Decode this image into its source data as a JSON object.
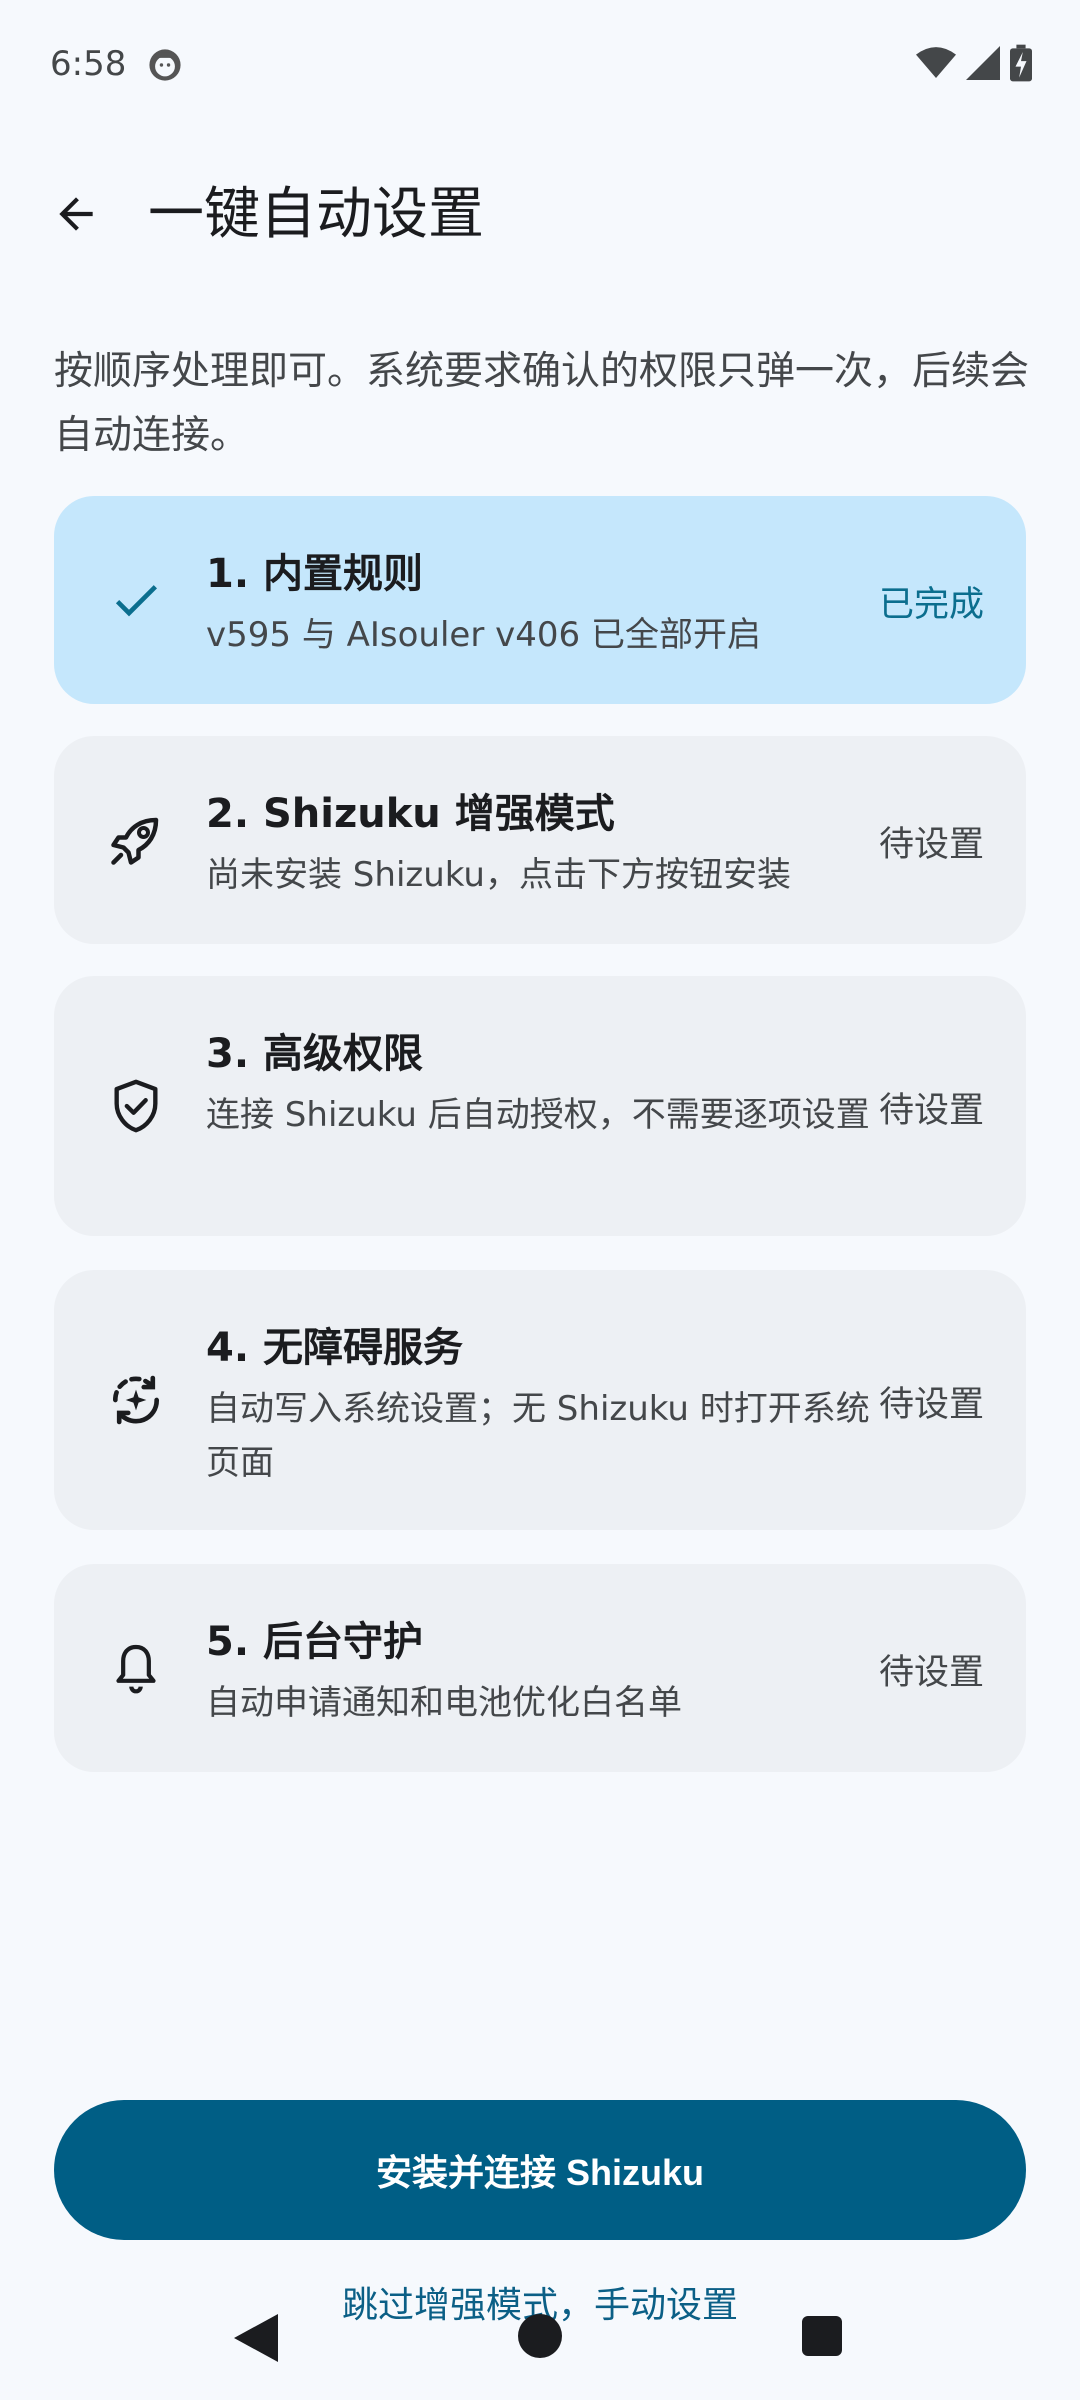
{
  "status_bar": {
    "time": "6:58"
  },
  "header": {
    "title": "一键自动设置"
  },
  "intro": "按顺序处理即可。系统要求确认的权限只弹一次，后续会自动连接。",
  "steps": [
    {
      "title": "1. 内置规则",
      "subtitle": "v595 与 AIsouler v406 已全部开启",
      "status": "已完成",
      "icon": "check-icon"
    },
    {
      "title": "2. Shizuku 增强模式",
      "subtitle": "尚未安装 Shizuku，点击下方按钮安装",
      "status": "待设置",
      "icon": "rocket-icon"
    },
    {
      "title": "3. 高级权限",
      "subtitle": "连接 Shizuku 后自动授权，不需要逐项设置",
      "status": "待设置",
      "icon": "shield-check-icon"
    },
    {
      "title": "4. 无障碍服务",
      "subtitle": "自动写入系统设置；无 Shizuku 时打开系统页面",
      "status": "待设置",
      "icon": "auto-sparkle-icon"
    },
    {
      "title": "5. 后台守护",
      "subtitle": "自动申请通知和电池优化白名单",
      "status": "待设置",
      "icon": "bell-icon"
    }
  ],
  "primary_button": "安装并连接 Shizuku",
  "secondary_link": "跳过增强模式，手动设置",
  "colors": {
    "primary": "#005E85",
    "done_card": "#C5E7FC",
    "card": "#EDF0F4",
    "background": "#F6F9FD"
  }
}
